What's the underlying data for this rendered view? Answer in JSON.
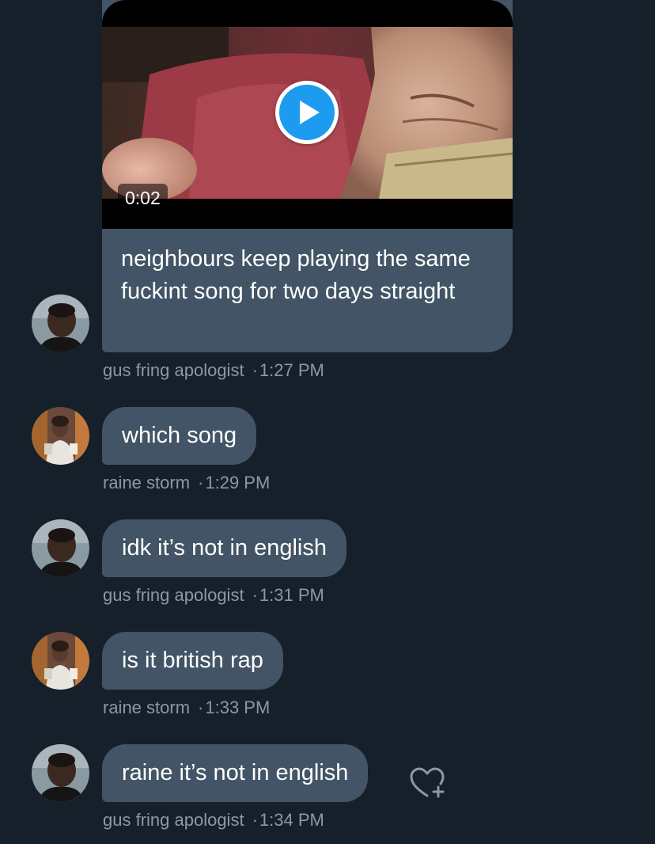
{
  "media_message": {
    "duration": "0:02",
    "caption": "neighbours keep playing the same fuckint song for two days straight",
    "sender": "gus fring apologist",
    "time": "1:27 PM"
  },
  "messages": [
    {
      "text": "which song",
      "sender": "raine storm",
      "time": "1:29 PM"
    },
    {
      "text": "idk it’s not in english",
      "sender": "gus fring apologist",
      "time": "1:31 PM"
    },
    {
      "text": "is it british rap",
      "sender": "raine storm",
      "time": "1:33 PM"
    },
    {
      "text": "raine it’s not in english",
      "sender": "gus fring apologist",
      "time": "1:34 PM"
    }
  ],
  "separator": "·",
  "icons": {
    "play": "play-icon",
    "react": "heart-add-icon"
  },
  "colors": {
    "background": "#15202b",
    "bubble": "#425465",
    "meta_text": "#8b98a5",
    "accent": "#1d9bf0"
  }
}
